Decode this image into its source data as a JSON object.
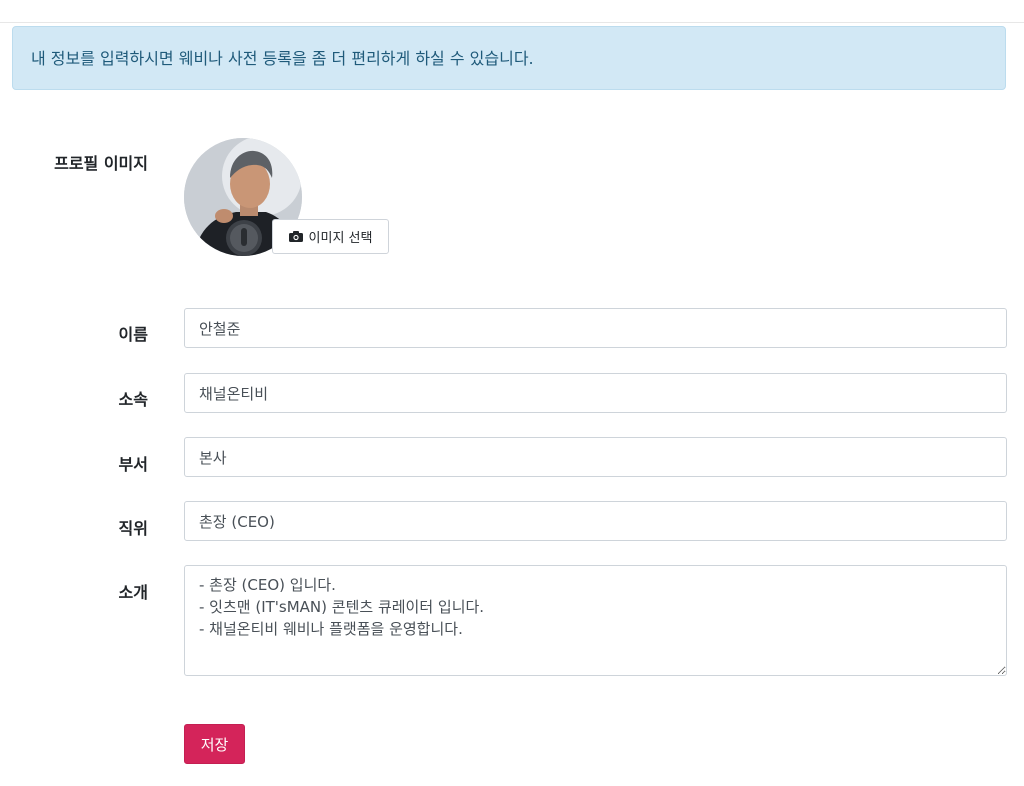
{
  "notice": {
    "text": "내 정보를 입력하시면 웨비나 사전 등록을 좀 더 편리하게 하실 수 있습니다."
  },
  "profile": {
    "image_label": "프로필 이미지",
    "select_image_button": "이미지 선택"
  },
  "fields": {
    "name": {
      "label": "이름",
      "value": "안철준"
    },
    "affiliation": {
      "label": "소속",
      "value": "채널온티비"
    },
    "department": {
      "label": "부서",
      "value": "본사"
    },
    "position": {
      "label": "직위",
      "value": "촌장 (CEO)"
    },
    "intro": {
      "label": "소개",
      "value": "- 촌장 (CEO) 입니다.\n- 잇츠맨 (IT'sMAN) 콘텐츠 큐레이터 입니다.\n- 채널온티비 웨비나 플랫폼을 운영합니다."
    }
  },
  "actions": {
    "save_label": "저장"
  },
  "colors": {
    "notice_bg": "#d2e8f5",
    "notice_text": "#1f5a7a",
    "primary": "#d4245a"
  },
  "icons": {
    "select_image": "camera-icon"
  }
}
